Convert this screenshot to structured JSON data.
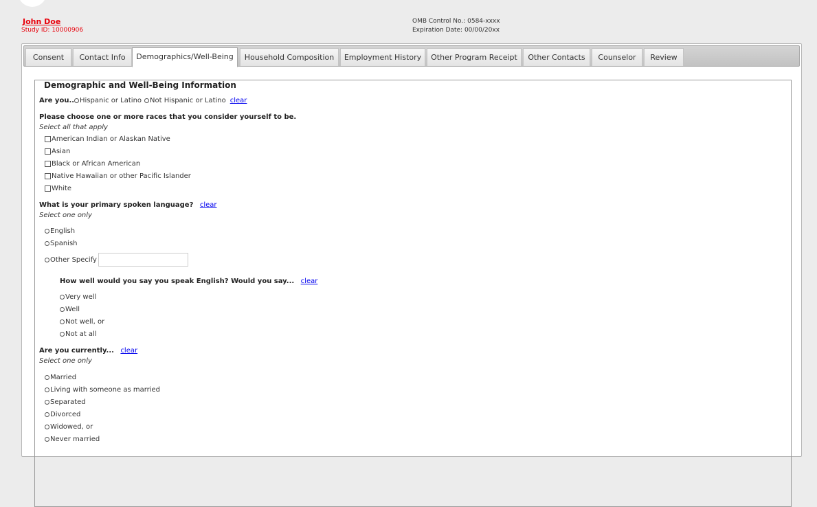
{
  "header": {
    "user_name": "John Doe",
    "study_id": "Study ID: 10000906",
    "omb_control": "OMB Control No.: 0584-xxxx",
    "expiration": "Expiration Date: 00/00/20xx"
  },
  "tabs": [
    {
      "label": "Consent"
    },
    {
      "label": "Contact Info"
    },
    {
      "label": "Demographics/Well-Being"
    },
    {
      "label": "Household Composition"
    },
    {
      "label": "Employment History"
    },
    {
      "label": "Other Program Receipt"
    },
    {
      "label": "Other Contacts"
    },
    {
      "label": "Counselor"
    },
    {
      "label": "Review"
    }
  ],
  "section": {
    "title": "Demographic and Well-Being Information",
    "clear_label": "clear",
    "ethnicity": {
      "question": "Are you...",
      "options": [
        "Hispanic or Latino",
        "Not Hispanic or Latino"
      ]
    },
    "race": {
      "question": "Please choose one or more races that you consider yourself to be.",
      "hint": "Select all that apply",
      "options": [
        "American Indian or Alaskan Native",
        "Asian",
        "Black or African American",
        "Native Hawaiian or other Pacific Islander",
        "White"
      ]
    },
    "language": {
      "question": "What is your primary spoken language?",
      "hint": "Select one only",
      "options": [
        "English",
        "Spanish",
        "Other Specify"
      ],
      "other_value": ""
    },
    "english": {
      "question": "How well would you say you speak English? Would you say...",
      "options": [
        "Very well",
        "Well",
        "Not well, or",
        "Not at all"
      ]
    },
    "marital": {
      "question": "Are you currently...",
      "hint": "Select one only",
      "options": [
        "Married",
        "Living with someone as married",
        "Separated",
        "Divorced",
        "Widowed, or",
        "Never married"
      ]
    }
  }
}
